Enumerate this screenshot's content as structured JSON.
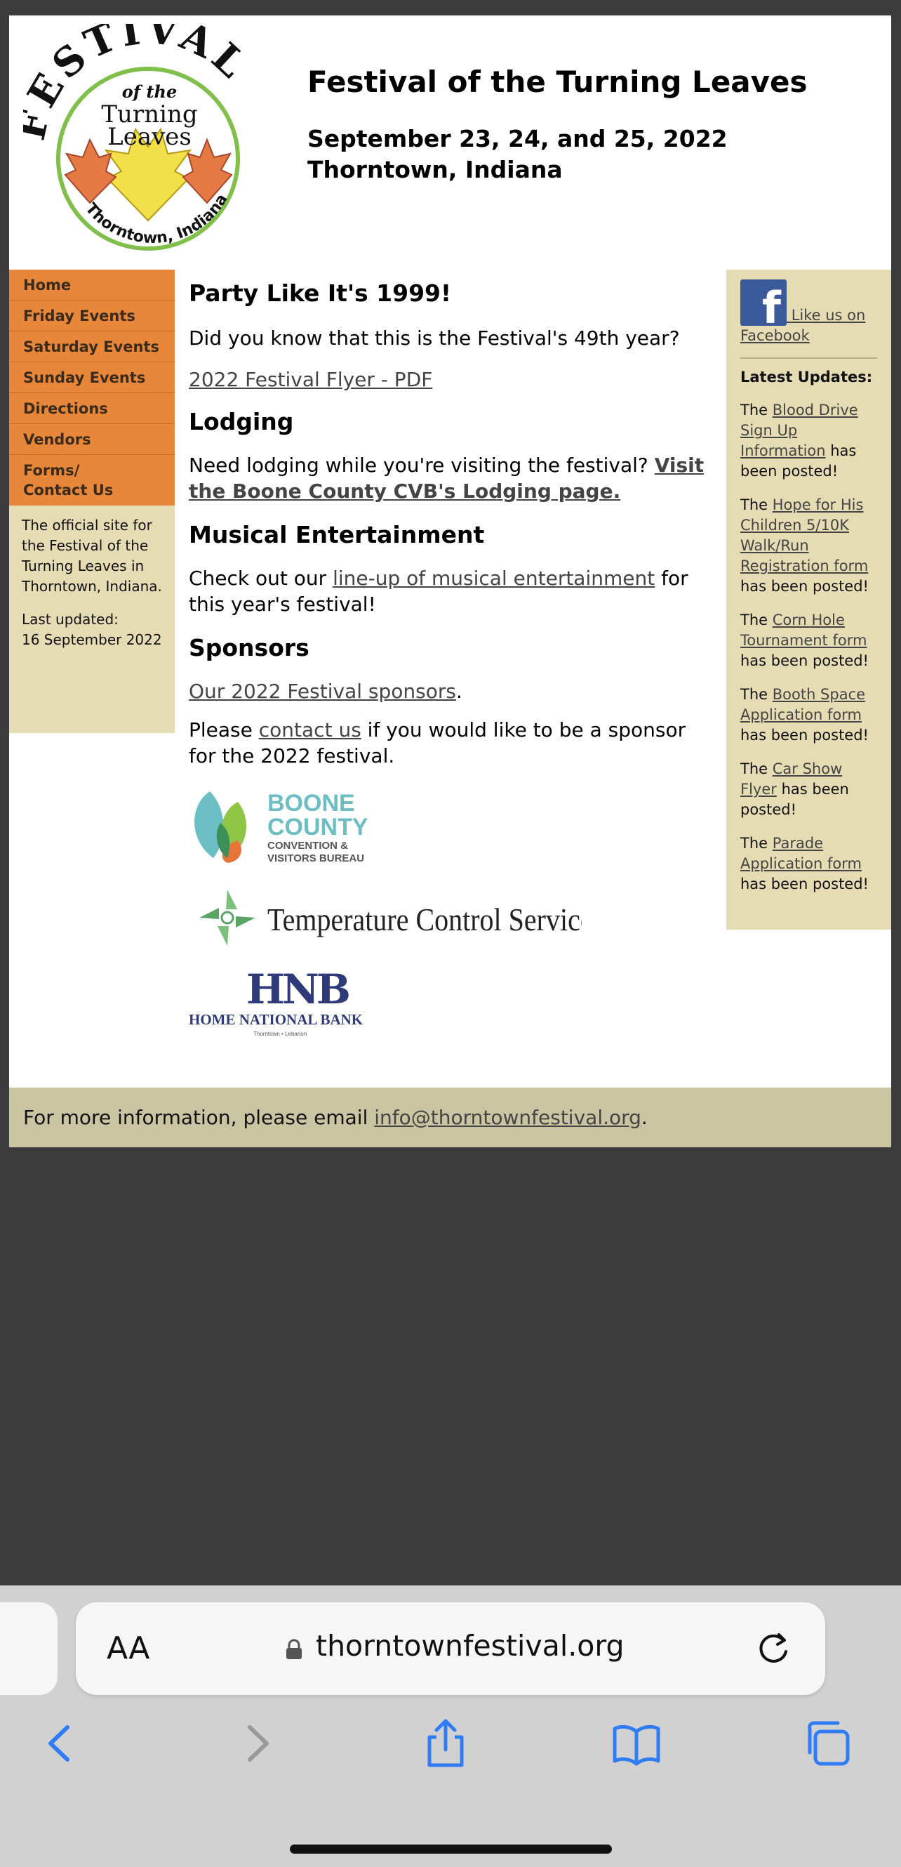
{
  "header": {
    "logo": {
      "arc_text": "FESTIVAL",
      "of_the": "of the",
      "line1": "Turning",
      "line2": "Leaves",
      "bottom_text": "Thorntown, Indiana"
    },
    "title": "Festival of the Turning Leaves",
    "dates": "September 23, 24, and 25, 2022",
    "location": "Thorntown, Indiana"
  },
  "nav": {
    "items": [
      {
        "label": "Home"
      },
      {
        "label": "Friday Events"
      },
      {
        "label": "Saturday Events"
      },
      {
        "label": "Sunday Events"
      },
      {
        "label": "Directions"
      },
      {
        "label": "Vendors"
      },
      {
        "label": "Forms/\nContact Us"
      }
    ]
  },
  "left_about": {
    "description": "The official site for the Festival of the Turning Leaves in Thorntown, Indiana.",
    "last_updated_label": "Last updated:",
    "last_updated": "16 September 2022"
  },
  "main": {
    "heading1": "Party Like It's 1999!",
    "p1": "Did you know that this is the Festival's 49th year?",
    "flyer_link": "2022 Festival Flyer - PDF",
    "lodging_heading": "Lodging",
    "lodging_text": "Need lodging while you're visiting the festival? ",
    "lodging_link": "Visit the Boone County CVB's Lodging page.",
    "music_heading": "Musical Entertainment",
    "music_pre": "Check out our ",
    "music_link": "line-up of musical entertainment",
    "music_post": " for this year's festival!",
    "sponsors_heading": "Sponsors",
    "sponsors_link": "Our 2022 Festival sponsors",
    "sponsors_period": ".",
    "contact_pre": "Please ",
    "contact_link": "contact us",
    "contact_post": " if you would like to be a sponsor for the 2022 festival.",
    "sponsor_logos": {
      "boone_line1": "BOONE",
      "boone_line2": "COUNTY",
      "boone_line3": "CONVENTION &",
      "boone_line4": "VISITORS BUREAU",
      "tcs": "Temperature Control Services",
      "hnb_mark": "HNB",
      "hnb_name": "HOME NATIONAL BANK",
      "hnb_sub": "Thorntown • Lebanon"
    }
  },
  "right": {
    "facebook_link": "Like us on Facebook",
    "updates_title": "Latest Updates:",
    "updates": [
      {
        "pre": "The ",
        "link": "Blood Drive Sign Up Information",
        "post": " has been posted!"
      },
      {
        "pre": "The ",
        "link": "Hope for His Children 5/10K Walk/Run Registration form",
        "post": " has been posted!"
      },
      {
        "pre": "The ",
        "link": "Corn Hole Tournament form",
        "post": " has been posted!"
      },
      {
        "pre": "The ",
        "link": "Booth Space Application form",
        "post": " has been posted!"
      },
      {
        "pre": "The ",
        "link": "Car Show Flyer",
        "post": " has been posted!"
      },
      {
        "pre": "The ",
        "link": "Parade Application form",
        "post": " has been posted!"
      }
    ]
  },
  "footer": {
    "text": "For more information, please email ",
    "email": "info@thorntownfestival.org",
    "period": "."
  },
  "browser": {
    "aa_label": "AA",
    "url": "thorntownfestival.org",
    "icons": [
      "back-icon",
      "forward-icon",
      "share-icon",
      "bookmarks-icon",
      "tabs-icon"
    ],
    "accent": "#2f7cf6"
  },
  "colors": {
    "nav_bg": "#e8873a",
    "sidebar_bg": "#e6dcb4",
    "footer_bg": "#c9c4a2",
    "outer_bg": "#3c3c3c"
  }
}
